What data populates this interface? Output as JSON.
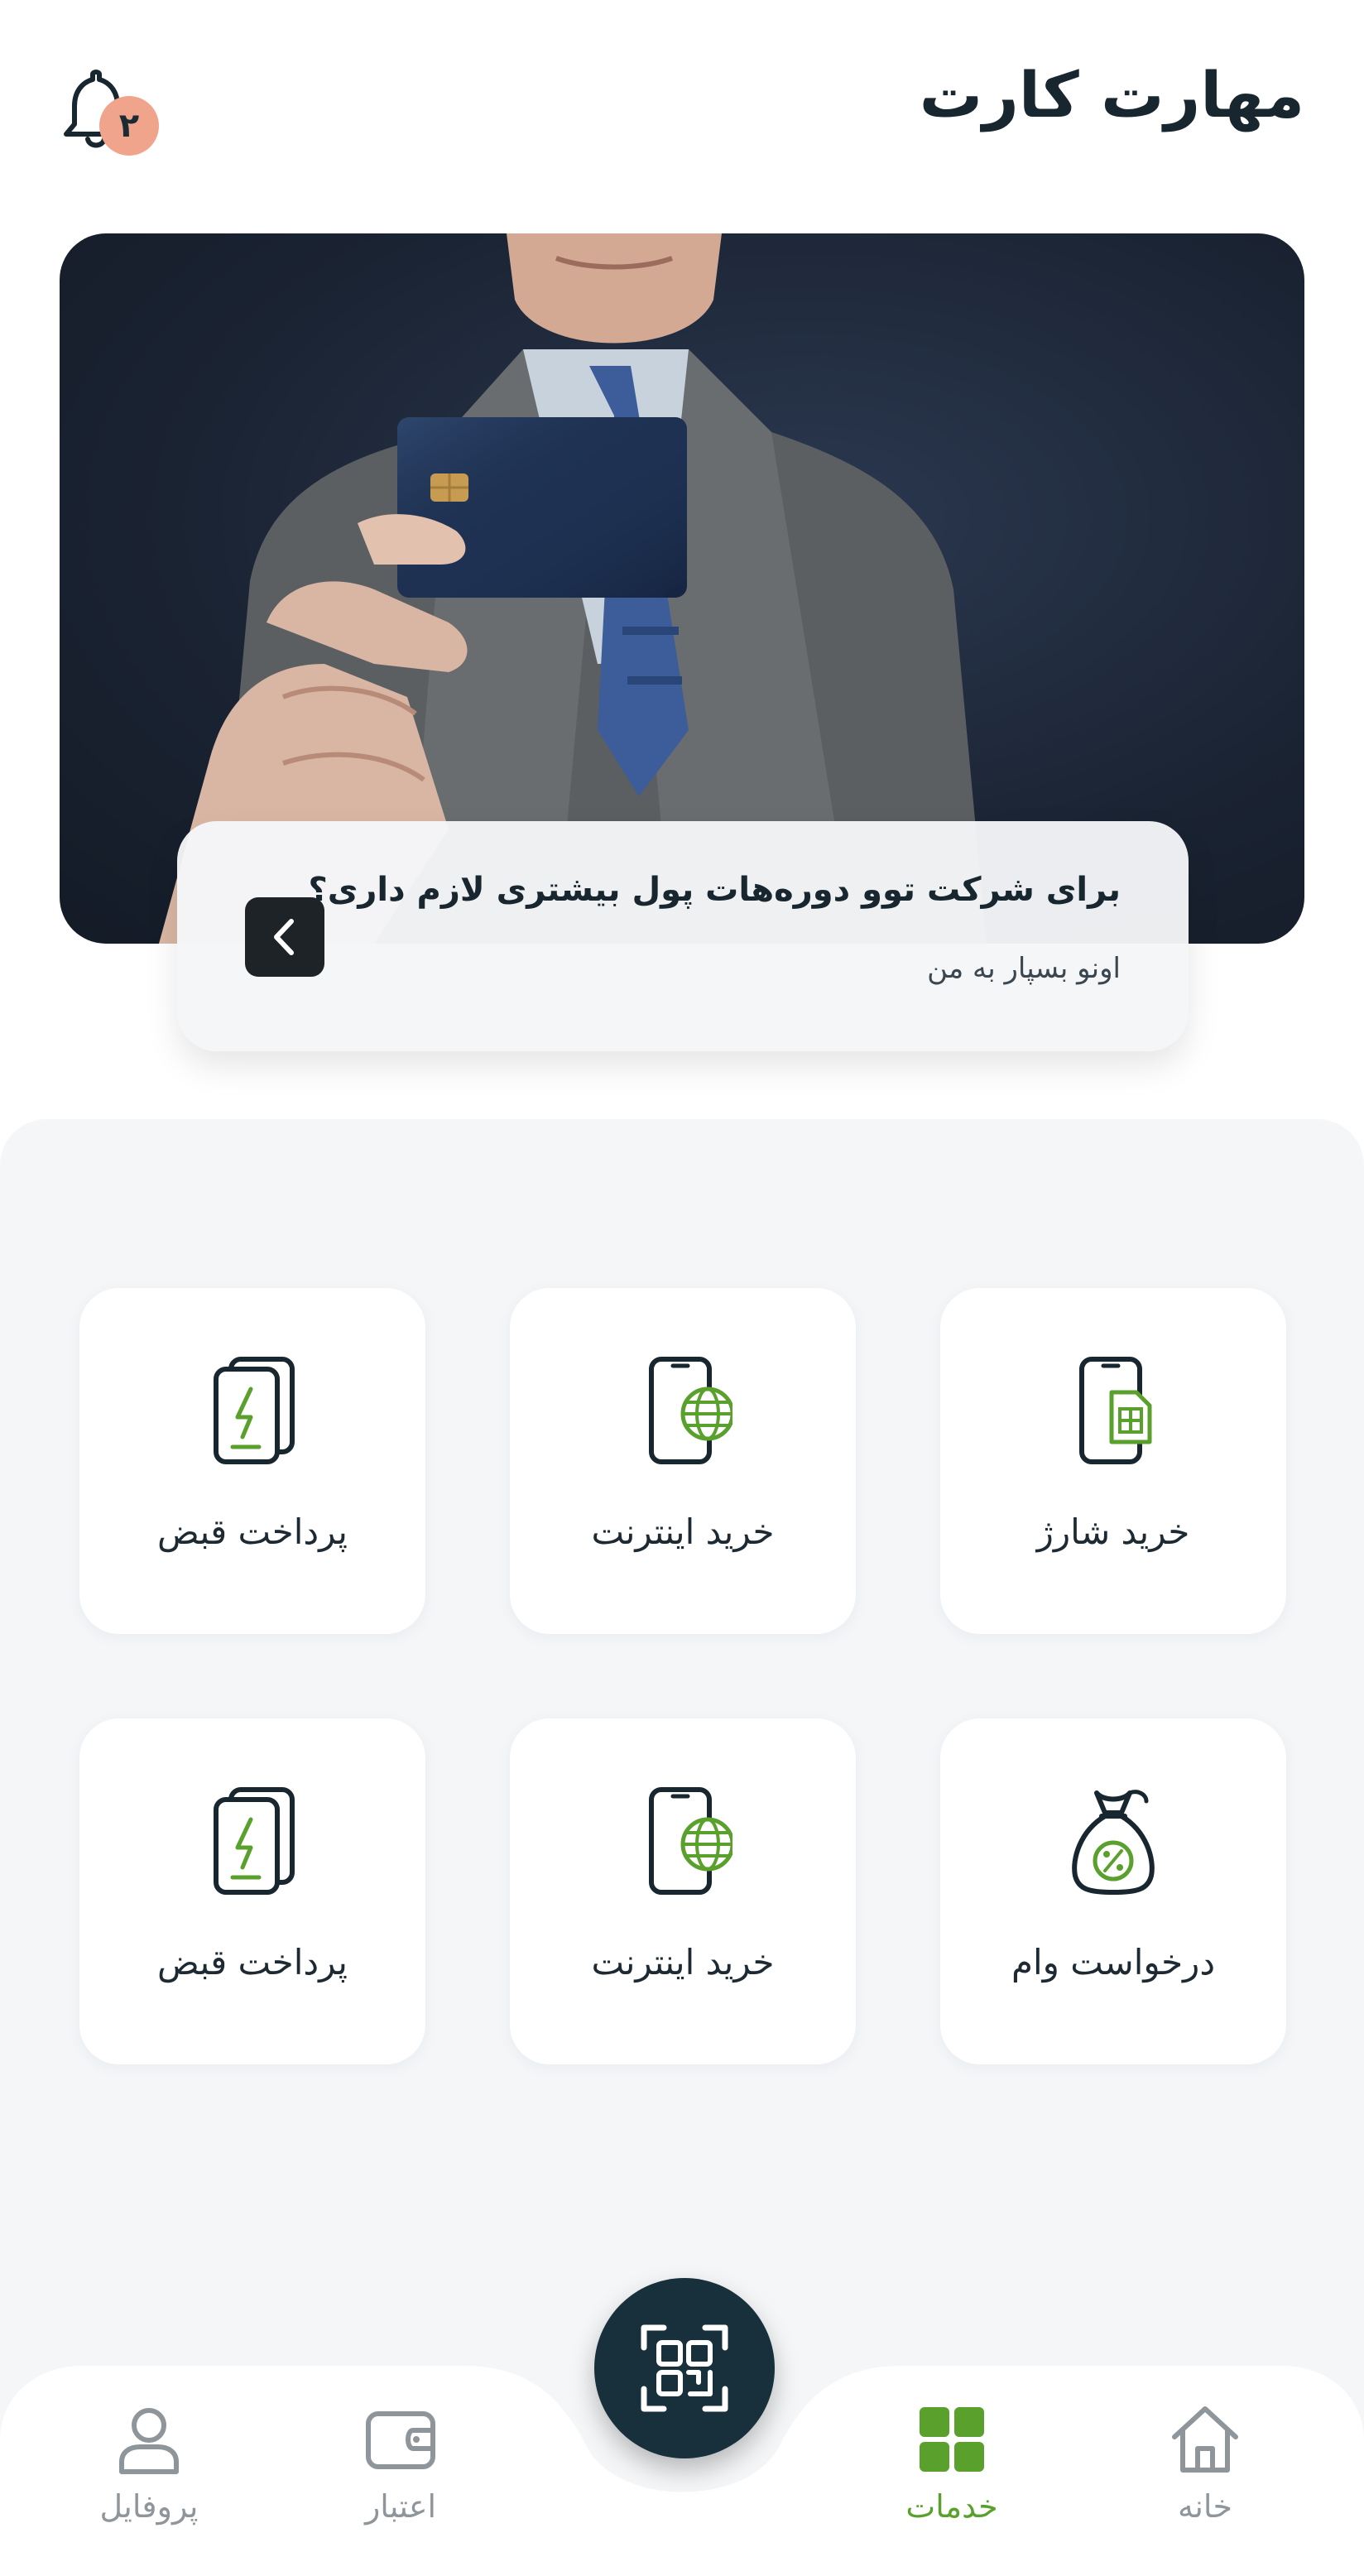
{
  "header": {
    "title": "مهارت کارت",
    "notification_count": "۲"
  },
  "promo": {
    "title": "برای شرکت توو دوره‌هات پول بیشتری لازم داری؟",
    "subtitle": "اونو بسپار به من"
  },
  "services": [
    {
      "label": "خرید شارژ",
      "icon": "sim-phone-icon"
    },
    {
      "label": "خرید اینترنت",
      "icon": "globe-phone-icon"
    },
    {
      "label": "پرداخت قبض",
      "icon": "bill-icon"
    },
    {
      "label": "درخواست وام",
      "icon": "money-bag-icon"
    },
    {
      "label": "خرید اینترنت",
      "icon": "globe-phone-icon"
    },
    {
      "label": "پرداخت قبض",
      "icon": "bill-icon"
    }
  ],
  "nav": {
    "home": "خانه",
    "services": "خدمات",
    "credit": "اعتبار",
    "profile": "پروفایل",
    "active": "services"
  },
  "colors": {
    "accent": "#5aa02c",
    "dark": "#17262f",
    "badge": "#f0a48c",
    "fab": "#17303b"
  }
}
